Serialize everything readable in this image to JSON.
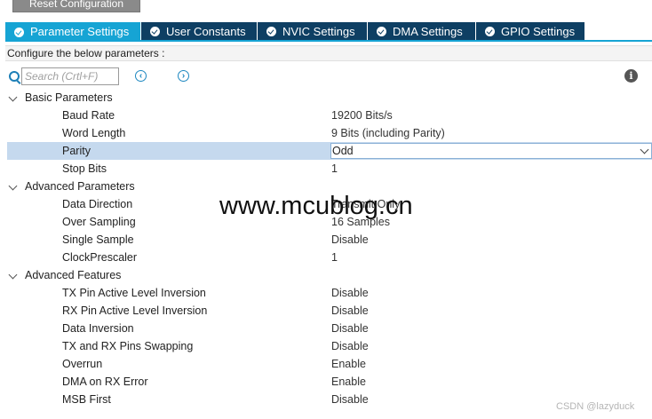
{
  "toolbar": {
    "reset_label": "Reset Configuration"
  },
  "tabs": [
    {
      "label": "Parameter Settings",
      "active": true
    },
    {
      "label": "User Constants",
      "active": false
    },
    {
      "label": "NVIC Settings",
      "active": false
    },
    {
      "label": "DMA Settings",
      "active": false
    },
    {
      "label": "GPIO Settings",
      "active": false
    }
  ],
  "configure_text": "Configure the below parameters :",
  "search": {
    "placeholder": "Search (Crtl+F)",
    "value": ""
  },
  "icons": {
    "search": "search-icon",
    "prev": "chevron-left-circle-icon",
    "next": "chevron-right-circle-icon",
    "info": "info-icon"
  },
  "colors": {
    "tab_active": "#16a4d4",
    "tab_inactive": "#0e3f63",
    "row_selected": "#c5d9ee"
  },
  "groups": [
    {
      "label": "Basic Parameters",
      "params": [
        {
          "name": "Baud Rate",
          "value": "19200 Bits/s"
        },
        {
          "name": "Word Length",
          "value": "9 Bits (including Parity)"
        },
        {
          "name": "Parity",
          "value": "Odd"
        },
        {
          "name": "Stop Bits",
          "value": "1"
        }
      ]
    },
    {
      "label": "Advanced Parameters",
      "params": [
        {
          "name": "Data Direction",
          "value": "Transmit Only"
        },
        {
          "name": "Over Sampling",
          "value": "16 Samples"
        },
        {
          "name": "Single Sample",
          "value": "Disable"
        },
        {
          "name": "ClockPrescaler",
          "value": "1"
        }
      ]
    },
    {
      "label": "Advanced Features",
      "params": [
        {
          "name": "TX Pin Active Level Inversion",
          "value": "Disable"
        },
        {
          "name": "RX Pin Active Level Inversion",
          "value": "Disable"
        },
        {
          "name": "Data Inversion",
          "value": "Disable"
        },
        {
          "name": "TX and RX Pins Swapping",
          "value": "Disable"
        },
        {
          "name": "Overrun",
          "value": "Enable"
        },
        {
          "name": "DMA on RX Error",
          "value": "Enable"
        },
        {
          "name": "MSB First",
          "value": "Disable"
        }
      ]
    }
  ],
  "watermark": "www.mcublog.cn",
  "credit": "CSDN @lazyduck"
}
